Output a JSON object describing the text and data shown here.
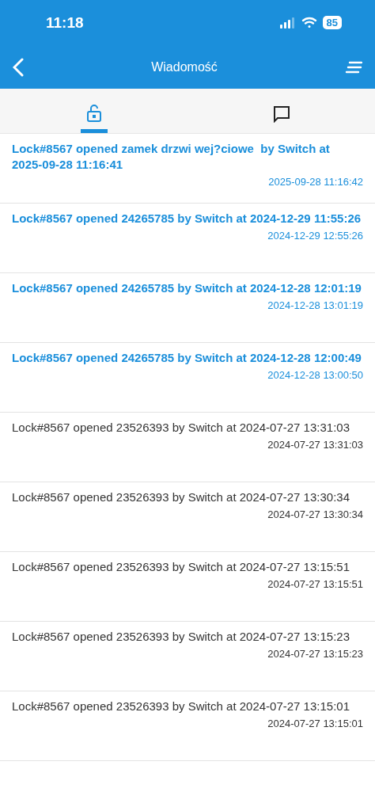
{
  "status_bar": {
    "time": "11:18",
    "battery": "85"
  },
  "nav": {
    "title": "Wiadomość"
  },
  "tabs": [
    {
      "kind": "lock",
      "selected": true
    },
    {
      "kind": "chat",
      "selected": false
    }
  ],
  "messages": [
    {
      "text": "Lock#8567 opened zamek drzwi wej?ciowe  by Switch at 2025-09-28 11:16:41",
      "time": "2025-09-28 11:16:42",
      "unread": true
    },
    {
      "text": "Lock#8567 opened 24265785 by Switch at 2024-12-29 11:55:26",
      "time": "2024-12-29 12:55:26",
      "unread": true
    },
    {
      "text": "Lock#8567 opened 24265785 by Switch at 2024-12-28 12:01:19",
      "time": "2024-12-28 13:01:19",
      "unread": true
    },
    {
      "text": "Lock#8567 opened 24265785 by Switch at 2024-12-28 12:00:49",
      "time": "2024-12-28 13:00:50",
      "unread": true
    },
    {
      "text": "Lock#8567 opened 23526393 by Switch at 2024-07-27 13:31:03",
      "time": "2024-07-27 13:31:03",
      "unread": false
    },
    {
      "text": "Lock#8567 opened 23526393 by Switch at 2024-07-27 13:30:34",
      "time": "2024-07-27 13:30:34",
      "unread": false
    },
    {
      "text": "Lock#8567 opened 23526393 by Switch at 2024-07-27 13:15:51",
      "time": "2024-07-27 13:15:51",
      "unread": false
    },
    {
      "text": "Lock#8567 opened 23526393 by Switch at 2024-07-27 13:15:23",
      "time": "2024-07-27 13:15:23",
      "unread": false
    },
    {
      "text": "Lock#8567 opened 23526393 by Switch at 2024-07-27 13:15:01",
      "time": "2024-07-27 13:15:01",
      "unread": false
    }
  ]
}
